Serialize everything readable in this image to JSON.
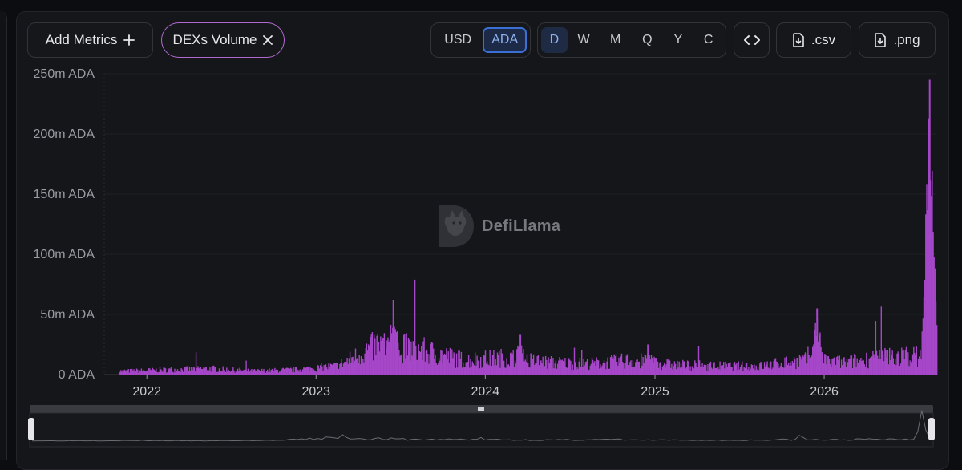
{
  "toolbar": {
    "add_metrics_label": "Add Metrics",
    "metric_chip_label": "DEXs Volume",
    "currency_options": [
      "USD",
      "ADA"
    ],
    "currency_selected": "ADA",
    "period_options": [
      "D",
      "W",
      "M",
      "Q",
      "Y",
      "C"
    ],
    "period_selected": "D",
    "csv_label": ".csv",
    "png_label": ".png"
  },
  "brand": {
    "name": "DefiLlama"
  },
  "colors": {
    "series": "#a646c9",
    "accent": "#3b6fd6",
    "chip_border": "#b06ad0"
  },
  "chart_data": {
    "type": "bar",
    "ylabel": "",
    "xlabel": "",
    "ylim": [
      0,
      250000000
    ],
    "y_ticks": [
      {
        "value": 0,
        "label": "0 ADA"
      },
      {
        "value": 50000000,
        "label": "50m ADA"
      },
      {
        "value": 100000000,
        "label": "100m ADA"
      },
      {
        "value": 150000000,
        "label": "150m ADA"
      },
      {
        "value": 200000000,
        "label": "200m ADA"
      },
      {
        "value": 250000000,
        "label": "250m ADA"
      }
    ],
    "x_ticks": [
      "2022",
      "2023",
      "2024",
      "2025",
      "2026"
    ],
    "grid": true,
    "series": [
      {
        "values_by_period": [
          {
            "period": "2021-Q4",
            "value": 3000000
          },
          {
            "period": "2022-Q1",
            "value": 4000000
          },
          {
            "period": "2022-Q2",
            "value": 5000000
          },
          {
            "period": "2022-Q3",
            "value": 3000000
          },
          {
            "period": "2022-Q4",
            "value": 4000000
          },
          {
            "period": "2023-Q1",
            "value": 7000000
          },
          {
            "period": "2023-Q2",
            "value": 25000000
          },
          {
            "period": "2023-Q3",
            "value": 20000000
          },
          {
            "period": "2023-Q4",
            "value": 12000000
          },
          {
            "period": "2024-Q1",
            "value": 14000000
          },
          {
            "period": "2024-Q2",
            "value": 10000000
          },
          {
            "period": "2024-Q3",
            "value": 9000000
          },
          {
            "period": "2024-Q4",
            "value": 12000000
          },
          {
            "period": "2025-Q1",
            "value": 8000000
          },
          {
            "period": "2025-Q2",
            "value": 7000000
          },
          {
            "period": "2025-Q3",
            "value": 7000000
          },
          {
            "period": "2025-Q4",
            "value": 12000000
          },
          {
            "period": "2026-Q1",
            "value": 10000000
          },
          {
            "period": "2026-Q2",
            "value": 15000000
          }
        ],
        "peaks": [
          {
            "date": "2023-06",
            "value": 62000000
          },
          {
            "date": "2024-03",
            "value": 33000000
          },
          {
            "date": "2024-12",
            "value": 25000000
          },
          {
            "date": "2025-12",
            "value": 55000000
          },
          {
            "date": "2026-08",
            "value": 245000000
          }
        ]
      }
    ]
  }
}
